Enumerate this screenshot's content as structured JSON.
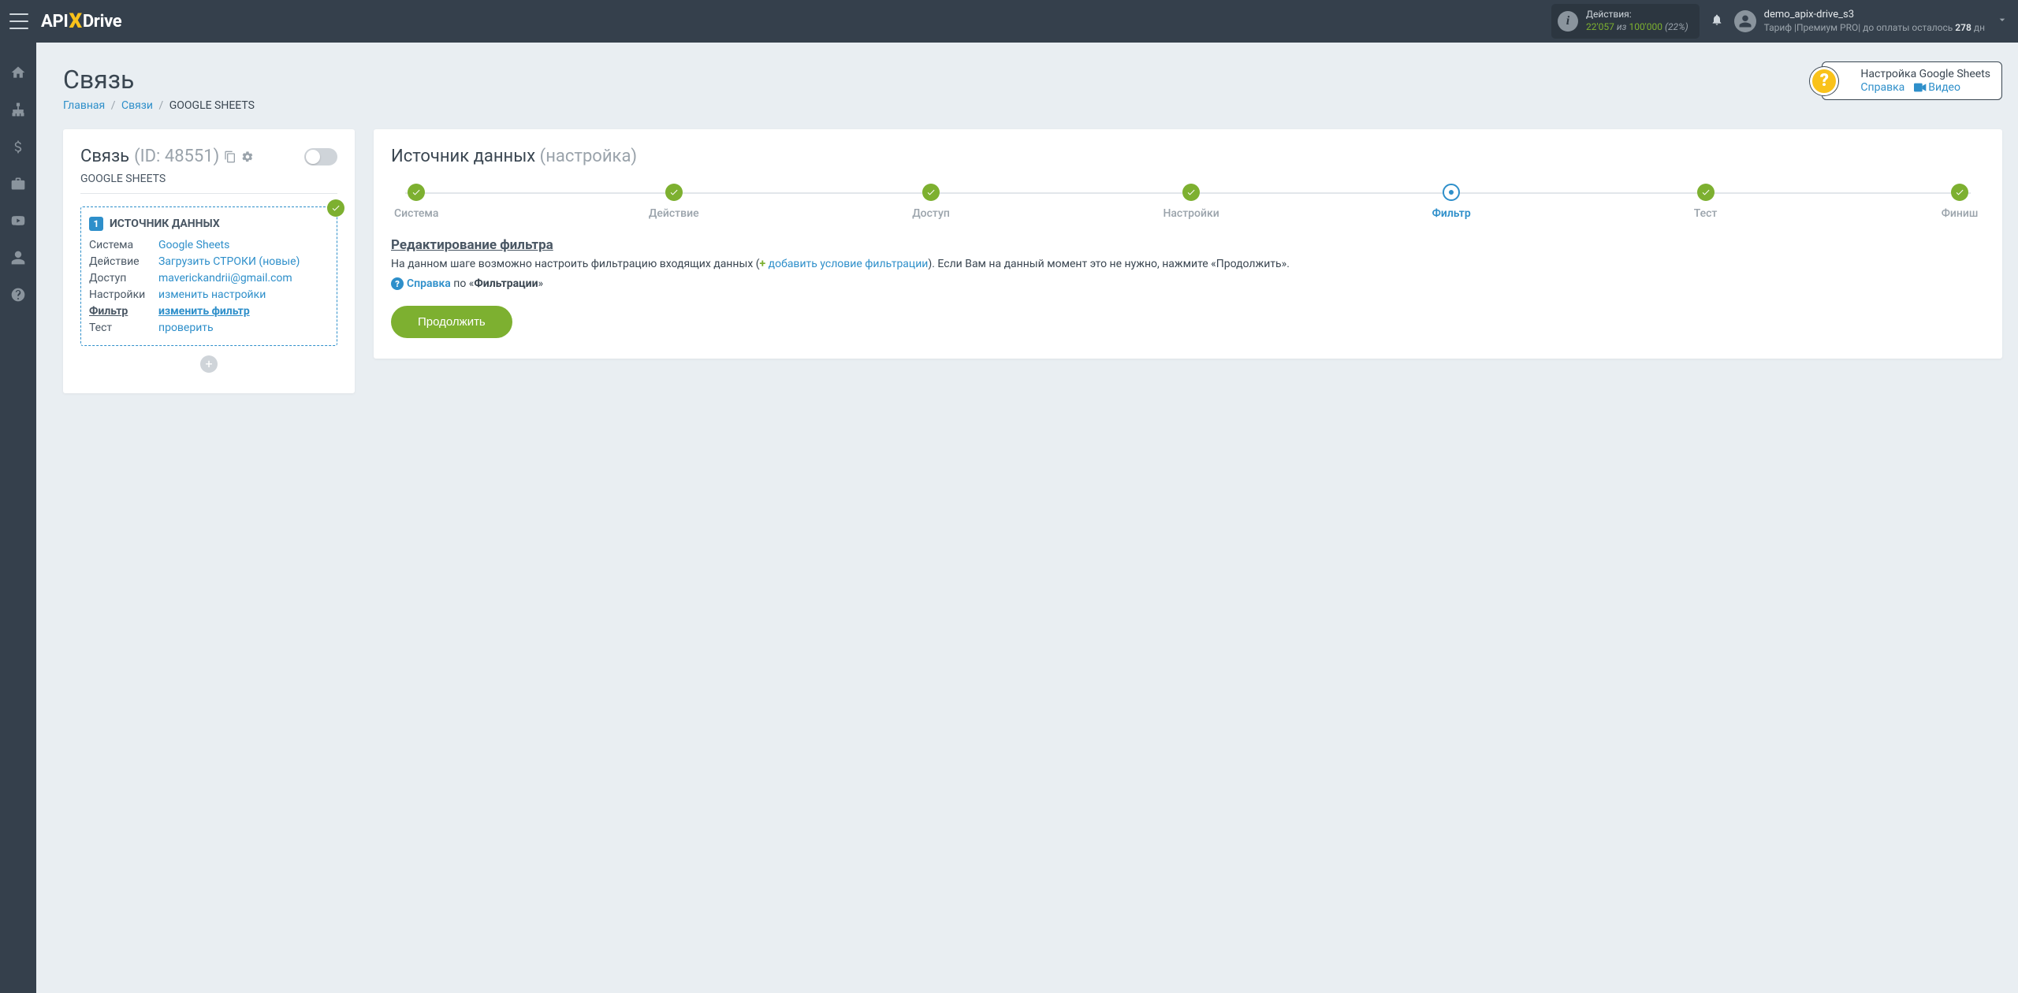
{
  "logo": {
    "api": "API",
    "x": "X",
    "drive": "Drive"
  },
  "topbar": {
    "actions_label": "Действия:",
    "actions_used": "22'057",
    "actions_of": "из",
    "actions_total": "100'000",
    "actions_pct": "(22%)",
    "user_name": "demo_apix-drive_s3",
    "tariff_prefix": "Тариф |Премиум PRO| до оплаты осталось ",
    "tariff_days": "278",
    "tariff_suffix": " дн"
  },
  "page": {
    "title": "Связь",
    "breadcrumbs": {
      "home": "Главная",
      "links": "Связи",
      "current": "GOOGLE SHEETS"
    }
  },
  "help_popup": {
    "title": "Настройка Google Sheets",
    "ref": "Справка",
    "video": "Видео"
  },
  "left_card": {
    "title": "Связь",
    "id_label": "(ID: 48551)",
    "subtitle": "GOOGLE SHEETS",
    "source_label": "ИСТОЧНИК ДАННЫХ",
    "rows": {
      "system_key": "Система",
      "system_val": "Google Sheets",
      "action_key": "Действие",
      "action_val": "Загрузить СТРОКИ (новые)",
      "access_key": "Доступ",
      "access_val": "maverickandrii@gmail.com",
      "settings_key": "Настройки",
      "settings_val": "изменить настройки",
      "filter_key": "Фильтр",
      "filter_val": "изменить фильтр",
      "test_key": "Тест",
      "test_val": "проверить"
    }
  },
  "right_card": {
    "title_main": "Источник данных",
    "title_sub": "(настройка)",
    "steps": [
      {
        "label": "Система",
        "state": "done"
      },
      {
        "label": "Действие",
        "state": "done"
      },
      {
        "label": "Доступ",
        "state": "done"
      },
      {
        "label": "Настройки",
        "state": "done"
      },
      {
        "label": "Фильтр",
        "state": "active"
      },
      {
        "label": "Тест",
        "state": "done"
      },
      {
        "label": "Финиш",
        "state": "done"
      }
    ],
    "section_title": "Редактирование фильтра",
    "desc_part1": "На данном шаге возможно настроить фильтрацию входящих данных (",
    "desc_add_link": "добавить условие фильтрации",
    "desc_part2": "). Если Вам на данный момент это не нужно, нажмите «Продолжить».",
    "help_ref": "Справка",
    "help_middle": " по «",
    "help_filter": "Фильтрации",
    "help_end": "»",
    "continue_btn": "Продолжить"
  }
}
